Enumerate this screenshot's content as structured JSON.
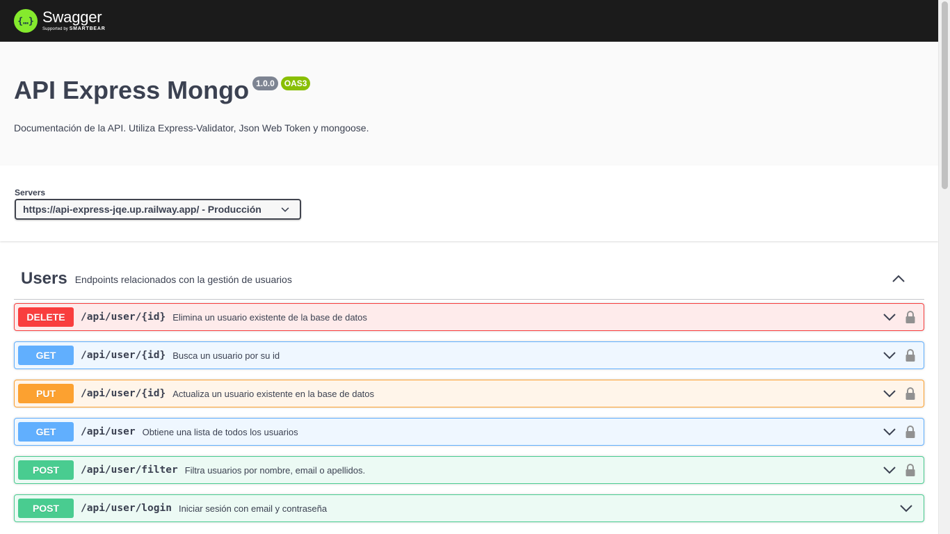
{
  "topbar": {
    "logo_name": "Swagger",
    "logo_sub_prefix": "Supported by",
    "logo_sub_brand": "SMARTBEAR"
  },
  "info": {
    "title": "API Express Mongo",
    "version": "1.0.0",
    "oas": "OAS3",
    "description": "Documentación de la API. Utiliza Express-Validator, Json Web Token y mongoose."
  },
  "servers": {
    "label": "Servers",
    "selected": "https://api-express-jqe.up.railway.app/ - Producción"
  },
  "section": {
    "tag_name": "Users",
    "tag_description": "Endpoints relacionados con la gestión de usuarios",
    "operations": [
      {
        "method": "DELETE",
        "path": "/api/user/{id}",
        "summary": "Elimina un usuario existente de la base de datos",
        "locked": true
      },
      {
        "method": "GET",
        "path": "/api/user/{id}",
        "summary": "Busca un usuario por su id",
        "locked": true
      },
      {
        "method": "PUT",
        "path": "/api/user/{id}",
        "summary": "Actualiza un usuario existente en la base de datos",
        "locked": true
      },
      {
        "method": "GET",
        "path": "/api/user",
        "summary": "Obtiene una lista de todos los usuarios",
        "locked": true
      },
      {
        "method": "POST",
        "path": "/api/user/filter",
        "summary": "Filtra usuarios por nombre, email o apellidos.",
        "locked": true
      },
      {
        "method": "POST",
        "path": "/api/user/login",
        "summary": "Iniciar sesión con email y contraseña",
        "locked": false
      }
    ]
  },
  "colors": {
    "delete": "#f93e3e",
    "get": "#61affe",
    "put": "#fca130",
    "post": "#49cc90",
    "topbar": "#1b1b1b",
    "logo_green": "#85ea2d",
    "oas_badge": "#89bf04",
    "version_badge": "#7d8492"
  }
}
